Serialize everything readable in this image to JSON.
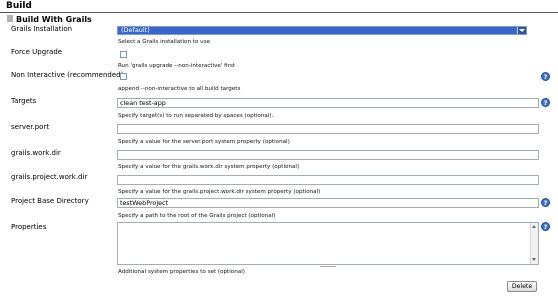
{
  "section": {
    "title": "Build"
  },
  "step": {
    "title": "Build With Grails"
  },
  "fields": {
    "grails_installation": {
      "label": "Grails Installation",
      "value": "(Default)",
      "description": "Select a Grails installation to use"
    },
    "force_upgrade": {
      "label": "Force Upgrade",
      "description": "Run 'grails upgrade --non-interactive' first"
    },
    "non_interactive": {
      "label": "Non Interactive (recommended)",
      "description": "append --non-interactive to all build targets"
    },
    "targets": {
      "label": "Targets",
      "value": "clean test-app",
      "description": "Specify target(s) to run separated by spaces (optional)."
    },
    "server_port": {
      "label": "server.port",
      "value": "",
      "description": "Specify a value for the server.port system property (optional)"
    },
    "grails_work_dir": {
      "label": "grails.work.dir",
      "value": "",
      "description": "Specify a value for the grails.work.dir system property (optional)"
    },
    "grails_project_work_dir": {
      "label": "grails.project.work.dir",
      "value": "",
      "description": "Specify a value for the grails.project.work.dir system property (optional)"
    },
    "project_base_directory": {
      "label": "Project Base Directory",
      "value": "testWebProject",
      "description": "Specify a path to the root of the Grails project (optional)"
    },
    "properties": {
      "label": "Properties",
      "value": "",
      "description": "Additional system properties to set (optional)"
    }
  },
  "help_icon_glyph": "?",
  "delete_button": {
    "label": "Delete"
  },
  "colors": {
    "select_bg": "#3a67c9",
    "help_icon": "#3b72c8"
  }
}
